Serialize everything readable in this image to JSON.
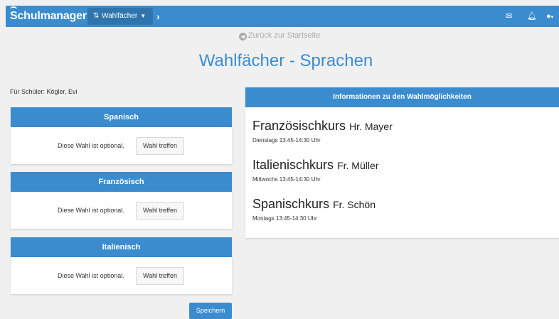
{
  "navbar": {
    "brand": "Schulmanager",
    "dropdown_label": "Wahlfächer",
    "next_icon": "chevron-right-icon",
    "icons": [
      "mail-icon",
      "bell-icon",
      "user-icon"
    ]
  },
  "back_link": "Zurück zur Startseite",
  "page_title": "Wahlfächer - Sprachen",
  "student_label": "Für Schüler: Kögler, Evi",
  "choices": [
    {
      "title": "Spanisch",
      "optional_text": "Diese Wahl ist optional.",
      "button": "Wahl treffen"
    },
    {
      "title": "Französisch",
      "optional_text": "Diese Wahl ist optional.",
      "button": "Wahl treffen"
    },
    {
      "title": "Italienisch",
      "optional_text": "Diese Wahl ist optional.",
      "button": "Wahl treffen"
    }
  ],
  "save_button": "Speichern",
  "info": {
    "title": "Informationen zu den Wahlmöglichkeiten",
    "courses": [
      {
        "name": "Französischkurs",
        "teacher": "Hr. Mayer",
        "time": "Dienstags 13:45-14:30 Uhr"
      },
      {
        "name": "Italienischkurs",
        "teacher": "Fr. Müller",
        "time": "Mittwochs 13:45-14:30 Uhr"
      },
      {
        "name": "Spanischkurs",
        "teacher": "Fr. Schön",
        "time": "Montags 13:45-14:30 Uhr"
      }
    ]
  },
  "colors": {
    "primary": "#3a8ccf",
    "primary_dark": "#2f75ad",
    "background": "#f0f0f0"
  }
}
